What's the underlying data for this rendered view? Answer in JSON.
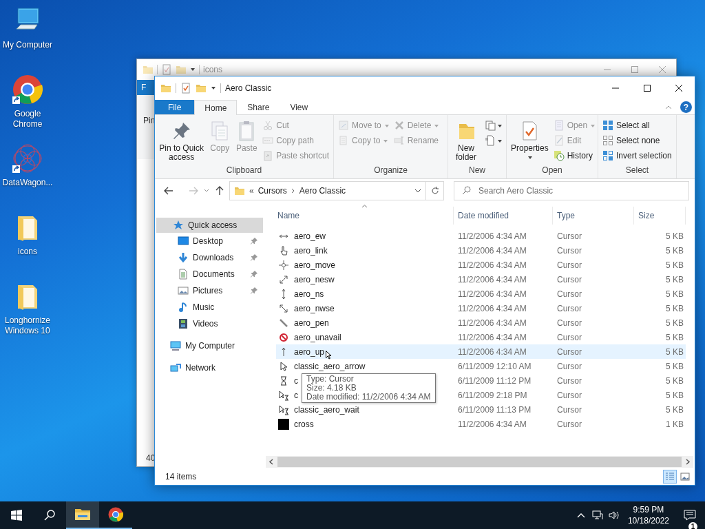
{
  "desktop_icons": [
    {
      "label": "My Computer",
      "kind": "computer",
      "shortcut": false
    },
    {
      "label": "Google Chrome",
      "kind": "browser",
      "shortcut": true
    },
    {
      "label": "DataWagon...",
      "kind": "app",
      "shortcut": true
    },
    {
      "label": "icons",
      "kind": "folder",
      "shortcut": false
    },
    {
      "label": "Longhornize Windows 10",
      "kind": "folder",
      "shortcut": false
    }
  ],
  "back_window": {
    "title": "icons",
    "file_tab": "F",
    "ribbon_fragment": "Pin",
    "status_fragment": "40"
  },
  "window": {
    "title": "Aero Classic",
    "tabs": [
      {
        "label": "File",
        "kind": "file",
        "selected": false
      },
      {
        "label": "Home",
        "kind": "tab",
        "selected": true
      },
      {
        "label": "Share",
        "kind": "tab",
        "selected": false
      },
      {
        "label": "View",
        "kind": "tab",
        "selected": false
      }
    ],
    "help_label": "?",
    "ribbon_groups": [
      {
        "label": "Clipboard",
        "columns": [
          [
            {
              "kind": "large",
              "label": "Pin to Quick access",
              "menu": false,
              "disabled": false
            }
          ],
          [
            {
              "kind": "large",
              "label": "Copy",
              "menu": false,
              "disabled": true
            }
          ],
          [
            {
              "kind": "large",
              "label": "Paste",
              "menu": false,
              "disabled": true
            }
          ],
          [
            {
              "kind": "small",
              "label": "Cut",
              "menu": false,
              "disabled": true
            },
            {
              "kind": "small",
              "label": "Copy path",
              "menu": false,
              "disabled": true
            },
            {
              "kind": "small",
              "label": "Paste shortcut",
              "menu": false,
              "disabled": true
            }
          ]
        ]
      },
      {
        "label": "Organize",
        "columns": [
          [
            {
              "kind": "small",
              "label": "Move to",
              "menu": true,
              "disabled": true
            },
            {
              "kind": "small",
              "label": "Copy to",
              "menu": true,
              "disabled": true
            }
          ],
          [
            {
              "kind": "small",
              "label": "Delete",
              "menu": true,
              "disabled": true
            },
            {
              "kind": "small",
              "label": "Rename",
              "menu": false,
              "disabled": true
            }
          ]
        ]
      },
      {
        "label": "New",
        "columns": [
          [
            {
              "kind": "large",
              "label": "New folder",
              "menu": false,
              "disabled": false
            }
          ],
          [
            {
              "kind": "icon",
              "menu": true,
              "disabled": false
            },
            {
              "kind": "icon",
              "menu": true,
              "disabled": false
            }
          ]
        ]
      },
      {
        "label": "Open",
        "columns": [
          [
            {
              "kind": "large",
              "label": "Properties",
              "menu": true,
              "disabled": false
            }
          ],
          [
            {
              "kind": "small",
              "label": "Open",
              "menu": true,
              "disabled": true
            },
            {
              "kind": "small",
              "label": "Edit",
              "menu": false,
              "disabled": true
            },
            {
              "kind": "small",
              "label": "History",
              "menu": false,
              "disabled": false
            }
          ]
        ]
      },
      {
        "label": "Select",
        "columns": [
          [
            {
              "kind": "small",
              "label": "Select all",
              "menu": false,
              "disabled": false
            },
            {
              "kind": "small",
              "label": "Select none",
              "menu": false,
              "disabled": false
            },
            {
              "kind": "small",
              "label": "Invert selection",
              "menu": false,
              "disabled": false
            }
          ]
        ]
      }
    ],
    "navigation_buttons": {
      "back_disabled": false,
      "forward_disabled": true
    },
    "address": {
      "overflow": "«",
      "path": [
        "Cursors",
        "Aero Classic"
      ]
    },
    "search": {
      "placeholder": "Search Aero Classic"
    },
    "navigation": [
      {
        "label": "Quick access",
        "selected": true,
        "children": [
          {
            "label": "Desktop",
            "pinned": true,
            "selected": false
          },
          {
            "label": "Downloads",
            "pinned": true,
            "selected": false
          },
          {
            "label": "Documents",
            "pinned": true,
            "selected": false
          },
          {
            "label": "Pictures",
            "pinned": true,
            "selected": false
          },
          {
            "label": "Music",
            "pinned": false,
            "selected": false
          },
          {
            "label": "Videos",
            "pinned": false,
            "selected": false
          }
        ]
      },
      {
        "label": "My Computer",
        "selected": false
      },
      {
        "label": "Network",
        "selected": false
      }
    ],
    "columns": [
      {
        "label": "Name",
        "sorted": true
      },
      {
        "label": "Date modified",
        "sorted": false
      },
      {
        "label": "Type",
        "sorted": false
      },
      {
        "label": "Size",
        "sorted": false
      }
    ],
    "files": [
      {
        "name": "aero_ew",
        "date": "11/2/2006 4:34 AM",
        "type": "Cursor",
        "size": "5 KB",
        "hovered": false
      },
      {
        "name": "aero_link",
        "date": "11/2/2006 4:34 AM",
        "type": "Cursor",
        "size": "5 KB",
        "hovered": false
      },
      {
        "name": "aero_move",
        "date": "11/2/2006 4:34 AM",
        "type": "Cursor",
        "size": "5 KB",
        "hovered": false
      },
      {
        "name": "aero_nesw",
        "date": "11/2/2006 4:34 AM",
        "type": "Cursor",
        "size": "5 KB",
        "hovered": false
      },
      {
        "name": "aero_ns",
        "date": "11/2/2006 4:34 AM",
        "type": "Cursor",
        "size": "5 KB",
        "hovered": false
      },
      {
        "name": "aero_nwse",
        "date": "11/2/2006 4:34 AM",
        "type": "Cursor",
        "size": "5 KB",
        "hovered": false
      },
      {
        "name": "aero_pen",
        "date": "11/2/2006 4:34 AM",
        "type": "Cursor",
        "size": "5 KB",
        "hovered": false
      },
      {
        "name": "aero_unavail",
        "date": "11/2/2006 4:34 AM",
        "type": "Cursor",
        "size": "5 KB",
        "hovered": false
      },
      {
        "name": "aero_up",
        "date": "11/2/2006 4:34 AM",
        "type": "Cursor",
        "size": "5 KB",
        "hovered": true
      },
      {
        "name": "classic_aero_arrow",
        "date": "6/11/2009 12:10 AM",
        "type": "Cursor",
        "size": "5 KB",
        "hovered": false
      },
      {
        "name": "c",
        "date": "6/11/2009 11:12 PM",
        "type": "Cursor",
        "size": "5 KB",
        "hovered": false
      },
      {
        "name": "c",
        "date": "6/11/2009 2:18 PM",
        "type": "Cursor",
        "size": "5 KB",
        "hovered": false
      },
      {
        "name": "classic_aero_wait",
        "date": "6/11/2009 11:13 PM",
        "type": "Cursor",
        "size": "5 KB",
        "hovered": false
      },
      {
        "name": "cross",
        "date": "11/2/2006 4:34 AM",
        "type": "Cursor",
        "size": "1 KB",
        "hovered": false
      }
    ],
    "tooltip": [
      "Type: Cursor",
      "Size: 4.18 KB",
      "Date modified: 11/2/2006 4:34 AM"
    ],
    "status": "14 items",
    "view_buttons": [
      {
        "selected": true
      },
      {
        "selected": false
      }
    ]
  },
  "taskbar": {
    "apps": [
      {
        "kind": "explorer",
        "active": true
      },
      {
        "kind": "browser",
        "active": false
      }
    ],
    "time": "9:59 PM",
    "date": "10/18/2022",
    "notification_count": "1"
  }
}
